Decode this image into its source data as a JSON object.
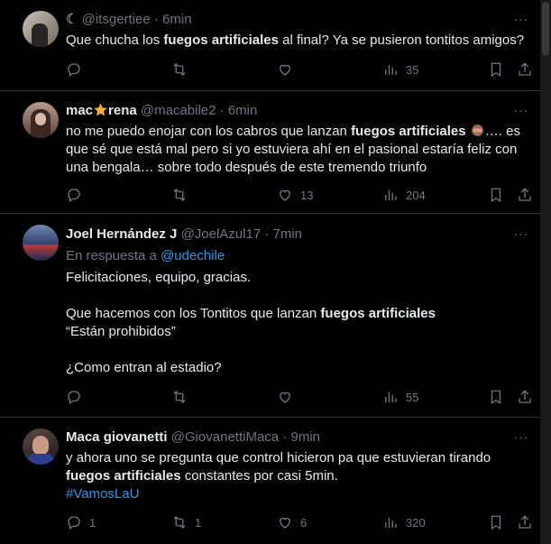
{
  "tweets": [
    {
      "name": "",
      "name_prefix": "☾",
      "handle": "@itsgertiee",
      "time": "6min",
      "text_before": "Que chucha los ",
      "text_bold": "fuegos artificiales",
      "text_after": " al final? Ya se pusieron tontitos amigos?",
      "views": "35",
      "likes": "",
      "retweets": "",
      "replies": ""
    },
    {
      "name_a": "mac",
      "name_b": "rena",
      "handle": "@macabile2",
      "time": "6min",
      "line1_before": "no me puedo enojar con los cabros que lanzan ",
      "line1_bold": "fuegos artificiales",
      "line1_after": "…. es",
      "line2": "que sé que está mal pero si yo estuviera ahí en el pasional estaría feliz con",
      "line3": "una bengala… sobre todo después de este tremendo triunfo",
      "likes": "13",
      "views": "204"
    },
    {
      "name": "Joel Hernández J",
      "handle": "@JoelAzul17",
      "time": "7min",
      "reply_prefix": "En respuesta a ",
      "reply_to": "@udechile",
      "p1": "Felicitaciones, equipo, gracias.",
      "p2_before": "Que hacemos con los Tontitos que lanzan ",
      "p2_bold": "fuegos artificiales",
      "p3": "“Están prohibidos”",
      "p4": "¿Como entran al estadio?",
      "views": "55"
    },
    {
      "name": "Maca giovanetti",
      "handle": "@GiovanettiMaca",
      "time": "9min",
      "line1": "y ahora uno se pregunta que control hicieron pa que estuvieran tirando",
      "line2_bold": "fuegos artificiales",
      "line2_after": " constantes por casi 5min.",
      "hashtag": "#VamosLaU",
      "replies": "1",
      "retweets": "1",
      "likes": "6",
      "views": "320"
    }
  ],
  "more_label": "···",
  "dot": "·"
}
